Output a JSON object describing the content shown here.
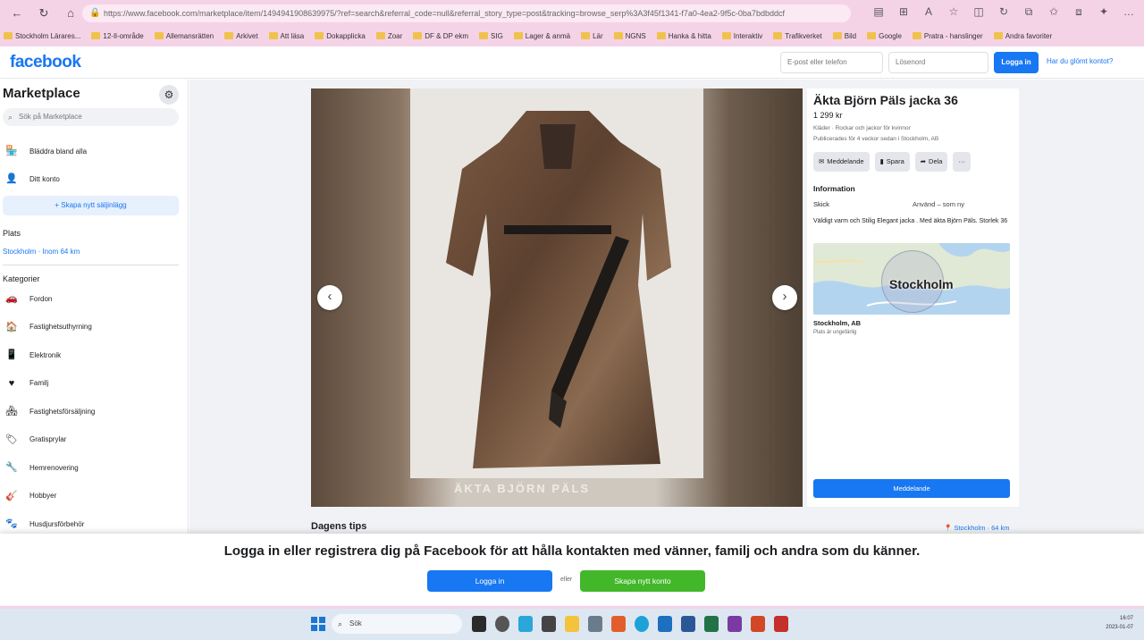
{
  "browser": {
    "url": "https://www.facebook.com/marketplace/item/1494941908639975/?ref=search&referral_code=null&referral_story_type=post&tracking=browse_serp%3A3f45f1341-f7a0-4ea2-9f5c-0ba7bdbddcf",
    "bookmarks": [
      "Stockholm Lärares...",
      "12-Il-område",
      "Allemansrätten",
      "Arkivet",
      "Att läsa",
      "Dokapplicka",
      "Zoar",
      "DF & DP ekm",
      "SIG",
      "Lager & anmä",
      "Lär",
      "NGNS",
      "Hanka & hitta",
      "Interaktiv",
      "Trafikverket",
      "Bild",
      "Google",
      "Pratra - hanslinger",
      "Andra favoriter"
    ]
  },
  "header": {
    "logo": "facebook",
    "email_placeholder": "E-post eller telefon",
    "password_placeholder": "Lösenord",
    "login_label": "Logga in",
    "forgot_label": "Har du glömt kontot?"
  },
  "sidebar": {
    "title": "Marketplace",
    "search_placeholder": "Sök på Marketplace",
    "nav": [
      {
        "icon": "storefront-icon",
        "label": "Bläddra bland alla"
      },
      {
        "icon": "person-icon",
        "label": "Ditt konto"
      }
    ],
    "create_label": "+ Skapa nytt säljinlägg",
    "location_heading": "Plats",
    "location_value": "Stockholm · Inom 64 km",
    "categories_heading": "Kategorier",
    "categories": [
      {
        "icon": "car-icon",
        "label": "Fordon"
      },
      {
        "icon": "house-icon",
        "label": "Fastighetsuthyrning"
      },
      {
        "icon": "phone-icon",
        "label": "Elektronik"
      },
      {
        "icon": "heart-icon",
        "label": "Familj"
      },
      {
        "icon": "home-sale-icon",
        "label": "Fastighetsförsäljning"
      },
      {
        "icon": "tag-icon",
        "label": "Gratisprylar"
      },
      {
        "icon": "tools-icon",
        "label": "Hemrenovering"
      },
      {
        "icon": "hobby-icon",
        "label": "Hobbyer"
      },
      {
        "icon": "pet-icon",
        "label": "Husdjursförbehör"
      }
    ]
  },
  "listing": {
    "title": "Äkta Björn Päls jacka 36",
    "price": "1 299 kr",
    "meta1": "Kläder · Rockar och jackor för kvinnor",
    "meta2": "Publicerades för 4 veckor sedan i Stockholm, AB",
    "actions": [
      "Meddelande",
      "Spara",
      "Dela",
      "···"
    ],
    "info_heading": "Information",
    "condition_label": "Skick",
    "condition_value": "Använd – som ny",
    "description": "Väldigt varm och Stilig Elegant jacka . Med äkta Björn Päls. Storlek 36",
    "map_label": "Stockholm",
    "location_city": "Stockholm, AB",
    "location_note": "Plats är ungefärlig",
    "message_button": "Meddelande",
    "photo_caption": "ÄKTA BJÖRN PÄLS"
  },
  "tips": {
    "heading": "Dagens tips",
    "location": "Stockholm · 64 km"
  },
  "banner": {
    "text": "Logga in eller registrera dig på Facebook för att hålla kontakten med vänner, familj och andra som du känner.",
    "login_label": "Logga in",
    "or_label": "eller",
    "create_label": "Skapa nytt konto"
  },
  "taskbar": {
    "search_label": "Sök",
    "time": "16:07",
    "date": "2023-01-07"
  },
  "colors": {
    "brand": "#1877f2",
    "create_green": "#42b72a",
    "browser_chrome": "#f5d3e6"
  }
}
